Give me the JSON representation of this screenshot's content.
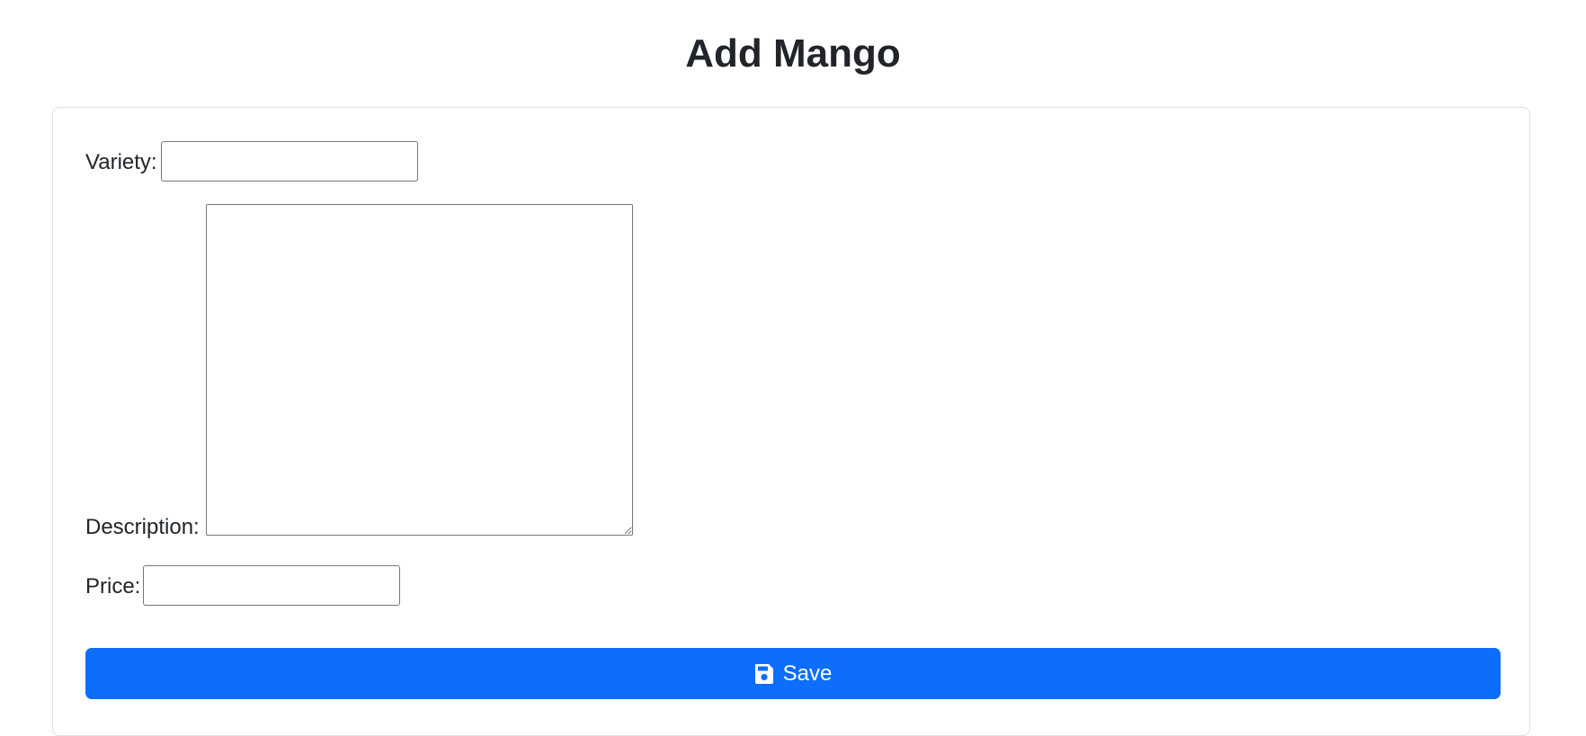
{
  "page": {
    "title": "Add Mango"
  },
  "form": {
    "variety_label": "Variety:",
    "variety_value": "",
    "description_label": "Description:",
    "description_value": "",
    "price_label": "Price:",
    "price_value": "",
    "save_label": "Save",
    "save_icon": "floppy-disk-icon"
  },
  "colors": {
    "primary": "#0d6efd",
    "text": "#212529",
    "card_border": "#dee2e6"
  }
}
